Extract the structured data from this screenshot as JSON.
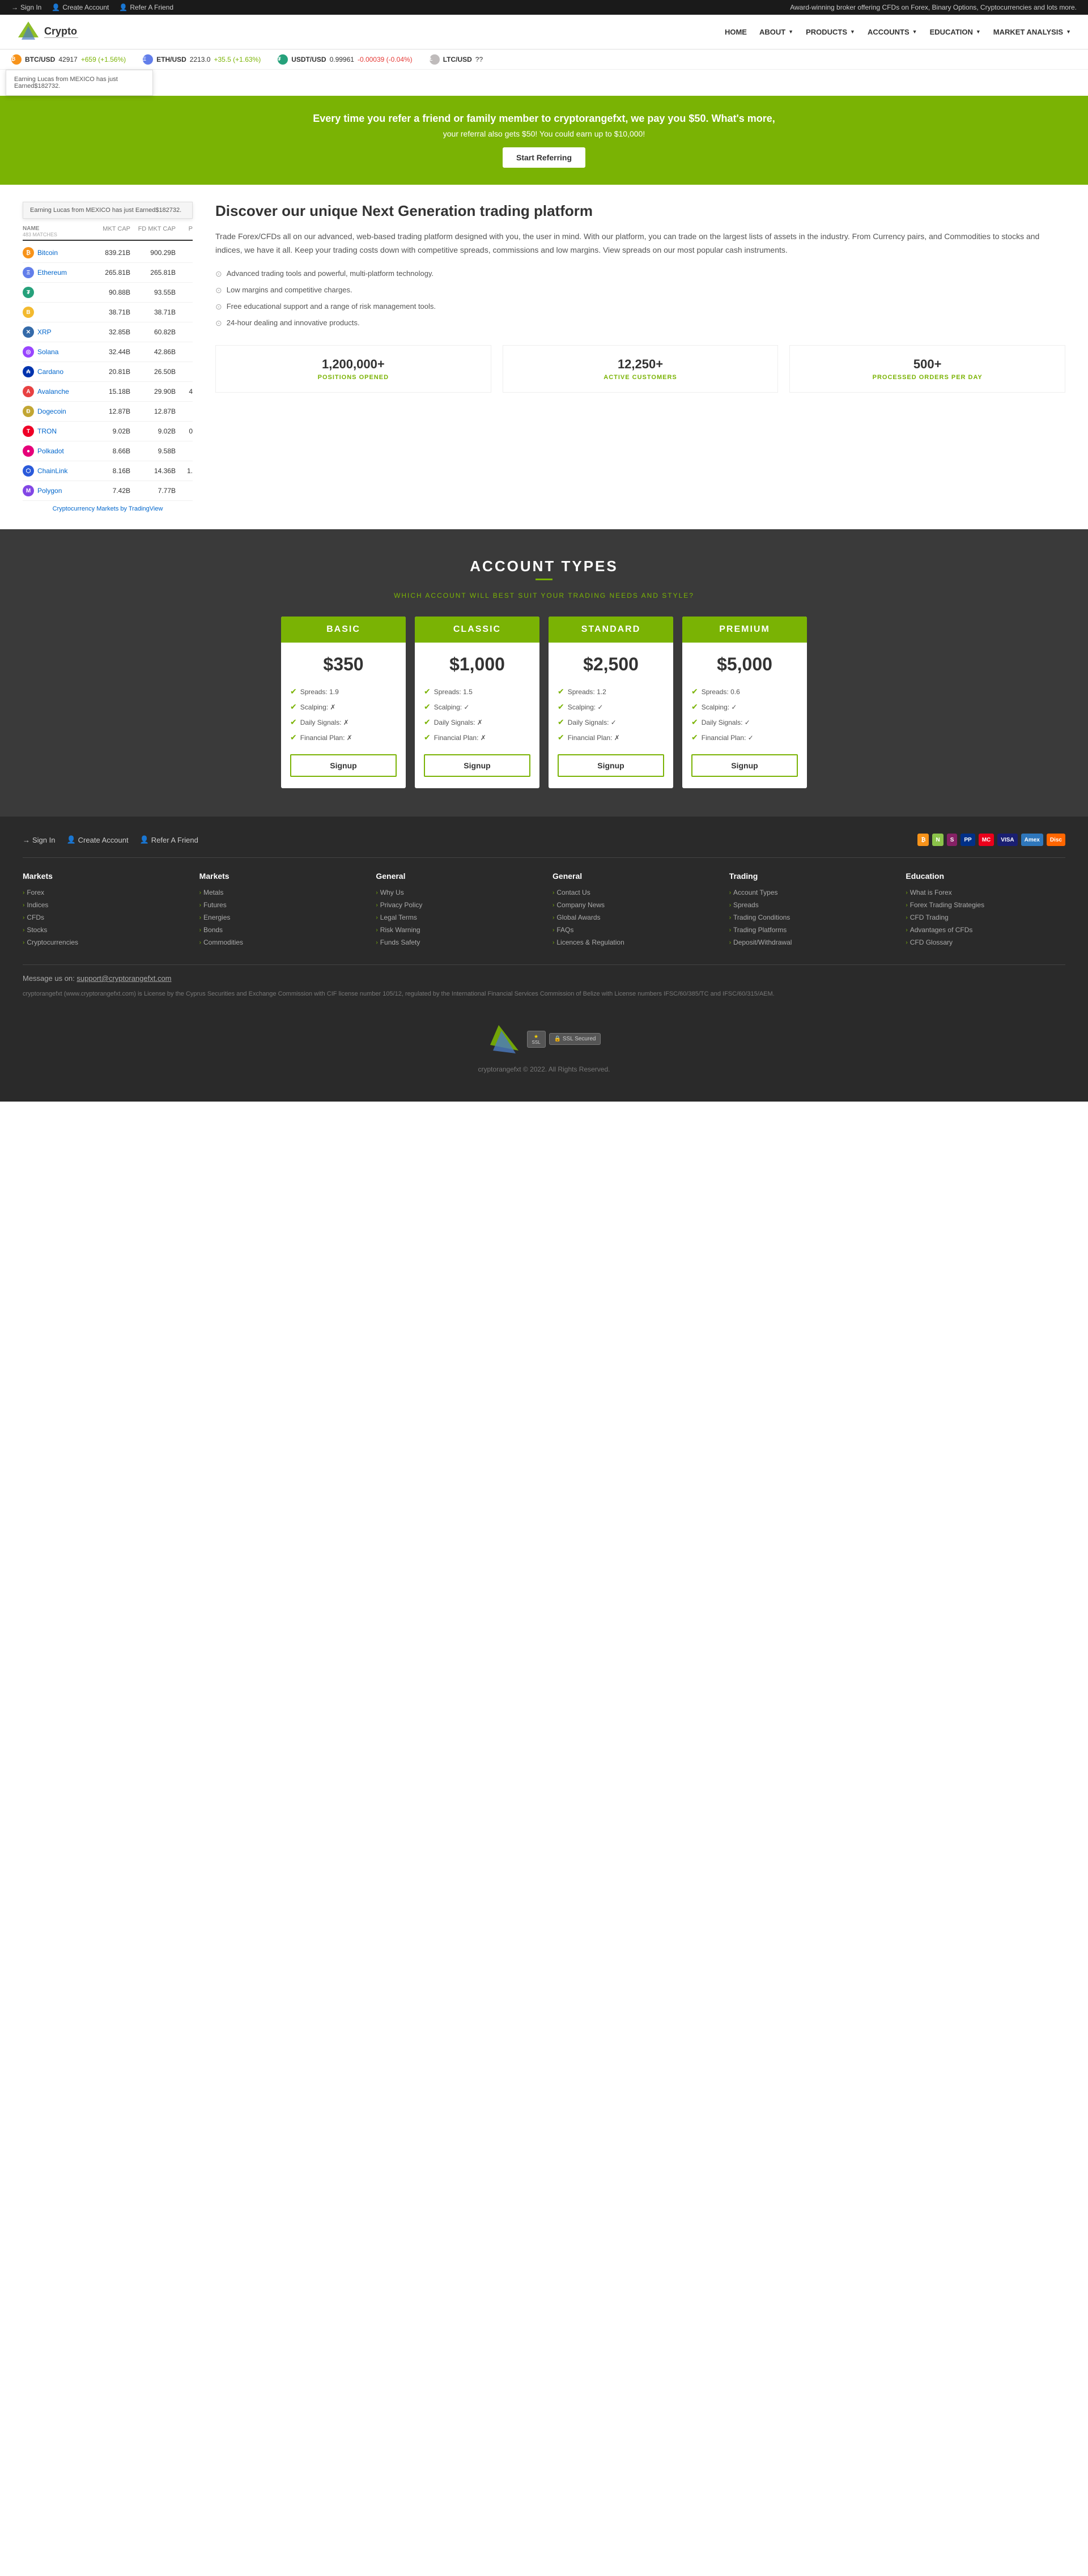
{
  "topbar": {
    "links": [
      {
        "label": "Sign In",
        "icon": "→"
      },
      {
        "label": "Create Account",
        "icon": "👤"
      },
      {
        "label": "Refer A Friend",
        "icon": "👤"
      }
    ],
    "announcement": "Award-winning broker offering CFDs on Forex, Binary Options, Cryptocurrencies and lots more."
  },
  "navbar": {
    "logo_name": "Crypto",
    "logo_sub": "___",
    "links": [
      {
        "label": "HOME"
      },
      {
        "label": "ABOUT",
        "dropdown": true
      },
      {
        "label": "PRODUCTS",
        "dropdown": true
      },
      {
        "label": "ACCOUNTS",
        "dropdown": true
      },
      {
        "label": "EDUCATION",
        "dropdown": true
      },
      {
        "label": "MARKET ANALYSIS",
        "dropdown": true
      }
    ]
  },
  "ticker": [
    {
      "symbol": "BTC/USD",
      "price": "42917",
      "change": "+659 (+1.56%)",
      "up": true,
      "color": "#f7931a"
    },
    {
      "symbol": "ETH/USD",
      "price": "2213.0",
      "change": "+35.5 (+1.63%)",
      "up": true,
      "color": "#627eea"
    },
    {
      "symbol": "USDT/USD",
      "price": "0.99961",
      "change": "-0.00039 (-0.04%)",
      "up": false,
      "color": "#26a17b"
    },
    {
      "symbol": "LTC/USD",
      "price": "??",
      "change": "",
      "up": true,
      "color": "#bfbbbb"
    }
  ],
  "notification": {
    "text": "Earning Lucas from MEXICO has just Earned$182732."
  },
  "referral": {
    "line1": "Every time you refer a friend or family member to cryptorangefxt, we pay you $50. What's more,",
    "line2": "your referral also gets $50! You could earn up to $10,000!",
    "button": "Start Referring"
  },
  "crypto_table": {
    "headers": [
      "NAME",
      "MKT CAP",
      "FD MKT CAP",
      "P"
    ],
    "subheaders": [
      "483 MATCHES",
      "",
      "",
      ""
    ],
    "rows": [
      {
        "name": "Bitcoin",
        "mkt_cap": "839.21B",
        "fd_mkt_cap": "900.29B",
        "p": "",
        "icon": "btc"
      },
      {
        "name": "Ethereum",
        "mkt_cap": "265.81B",
        "fd_mkt_cap": "265.81B",
        "p": "",
        "icon": "eth"
      },
      {
        "name": "",
        "mkt_cap": "90.88B",
        "fd_mkt_cap": "93.55B",
        "p": "",
        "icon": "usdt"
      },
      {
        "name": "",
        "mkt_cap": "38.71B",
        "fd_mkt_cap": "38.71B",
        "p": "",
        "icon": "bnb"
      },
      {
        "name": "XRP",
        "mkt_cap": "32.85B",
        "fd_mkt_cap": "60.82B",
        "p": "",
        "icon": "xrp"
      },
      {
        "name": "Solana",
        "mkt_cap": "32.44B",
        "fd_mkt_cap": "42.86B",
        "p": "",
        "icon": "sol"
      },
      {
        "name": "Cardano",
        "mkt_cap": "20.81B",
        "fd_mkt_cap": "26.50B",
        "p": "",
        "icon": "ada"
      },
      {
        "name": "Avalanche",
        "mkt_cap": "15.18B",
        "fd_mkt_cap": "29.90B",
        "p": "4",
        "icon": "avax"
      },
      {
        "name": "Dogecoin",
        "mkt_cap": "12.87B",
        "fd_mkt_cap": "12.87B",
        "p": "",
        "icon": "doge"
      },
      {
        "name": "TRON",
        "mkt_cap": "9.02B",
        "fd_mkt_cap": "9.02B",
        "p": "0",
        "icon": "tron"
      },
      {
        "name": "Polkadot",
        "mkt_cap": "8.66B",
        "fd_mkt_cap": "9.58B",
        "p": "",
        "icon": "dot"
      },
      {
        "name": "ChainLink",
        "mkt_cap": "8.16B",
        "fd_mkt_cap": "14.36B",
        "p": "1.",
        "icon": "link"
      },
      {
        "name": "Polygon",
        "mkt_cap": "7.42B",
        "fd_mkt_cap": "7.77B",
        "p": "",
        "icon": "matic"
      }
    ],
    "credit": "Cryptocurrency Markets by TradingView"
  },
  "platform": {
    "title": "Discover our unique Next Generation trading platform",
    "description": "Trade Forex/CFDs all on our advanced, web-based trading platform designed with you, the user in mind. With our platform, you can trade on the largest lists of assets in the industry. From Currency pairs, and Commodities to stocks and indices, we have it all. Keep your trading costs down with competitive spreads, commissions and low margins. View spreads on our most popular cash instruments.",
    "features": [
      "Advanced trading tools and powerful, multi-platform technology.",
      "Low margins and competitive charges.",
      "Free educational support and a range of risk management tools.",
      "24-hour dealing and innovative products."
    ],
    "stats": [
      {
        "number": "1,200,000+",
        "label": "POSITIONS OPENED"
      },
      {
        "number": "12,250+",
        "label": "ACTIVE CUSTOMERS"
      },
      {
        "number": "500+",
        "label": "PROCESSED ORDERS PER DAY"
      }
    ]
  },
  "account_types": {
    "title": "ACCOUNT TYPES",
    "subtitle": "WHICH ACCOUNT WILL BEST SUIT YOUR TRADING NEEDS AND STYLE?",
    "cards": [
      {
        "name": "BASIC",
        "price": "$350",
        "features": [
          {
            "label": "Spreads: 1.9",
            "check": true
          },
          {
            "label": "Scalping: ✗",
            "check": false
          },
          {
            "label": "Daily Signals: ✗",
            "check": false
          },
          {
            "label": "Financial Plan: ✗",
            "check": false
          }
        ],
        "button": "Signup"
      },
      {
        "name": "CLASSIC",
        "price": "$1,000",
        "features": [
          {
            "label": "Spreads: 1.5",
            "check": true
          },
          {
            "label": "Scalping: ✓",
            "check": true
          },
          {
            "label": "Daily Signals: ✗",
            "check": false
          },
          {
            "label": "Financial Plan: ✗",
            "check": false
          }
        ],
        "button": "Signup"
      },
      {
        "name": "STANDARD",
        "price": "$2,500",
        "features": [
          {
            "label": "Spreads: 1.2",
            "check": true
          },
          {
            "label": "Scalping: ✓",
            "check": true
          },
          {
            "label": "Daily Signals: ✓",
            "check": true
          },
          {
            "label": "Financial Plan: ✗",
            "check": false
          }
        ],
        "button": "Signup"
      },
      {
        "name": "PREMIUM",
        "price": "$5,000",
        "features": [
          {
            "label": "Spreads: 0.6",
            "check": true
          },
          {
            "label": "Scalping: ✓",
            "check": true
          },
          {
            "label": "Daily Signals: ✓",
            "check": true
          },
          {
            "label": "Financial Plan: ✓",
            "check": true
          }
        ],
        "button": "Signup"
      }
    ]
  },
  "footer": {
    "links": [
      {
        "label": "Sign In",
        "icon": "→"
      },
      {
        "label": "Create Account",
        "icon": "👤"
      },
      {
        "label": "Refer A Friend",
        "icon": "👤"
      }
    ],
    "payment_methods": [
      "Bitcoin",
      "Neteller",
      "Skrill",
      "PayPal",
      "MasterCard",
      "VISA",
      "Amex",
      "Discover"
    ],
    "columns": [
      {
        "title": "Markets",
        "items": [
          "Forex",
          "Indices",
          "CFDs",
          "Stocks",
          "Cryptocurrencies"
        ]
      },
      {
        "title": "Markets",
        "items": [
          "Metals",
          "Futures",
          "Energies",
          "Bonds",
          "Commodities"
        ]
      },
      {
        "title": "General",
        "items": [
          "Why Us",
          "Privacy Policy",
          "Legal Terms",
          "Risk Warning",
          "Funds Safety"
        ]
      },
      {
        "title": "General",
        "items": [
          "Contact Us",
          "Company News",
          "Global Awards",
          "FAQs",
          "Licences & Regulation"
        ]
      },
      {
        "title": "Trading",
        "items": [
          "Account Types",
          "Spreads",
          "Trading Conditions",
          "Trading Platforms",
          "Deposit/Withdrawal"
        ]
      },
      {
        "title": "Education",
        "items": [
          "What is Forex",
          "Forex Trading Strategies",
          "CFD Trading",
          "Advantages of CFDs",
          "CFD Glossary"
        ]
      }
    ],
    "email_label": "Message us on:",
    "email": "support@cryptorangefxt.com",
    "legal": "cryptorangefxt (www.cryptorangefxt.com) is License by the Cyprus Securities and Exchange Commission with CIF license number 105/12, regulated by the International Financial Services Commission of Belize with License numbers IFSC/60/385/TC and IFSC/60/315/AEM.",
    "copyright": "cryptorangefxt © 2022. All Rights Reserved."
  }
}
